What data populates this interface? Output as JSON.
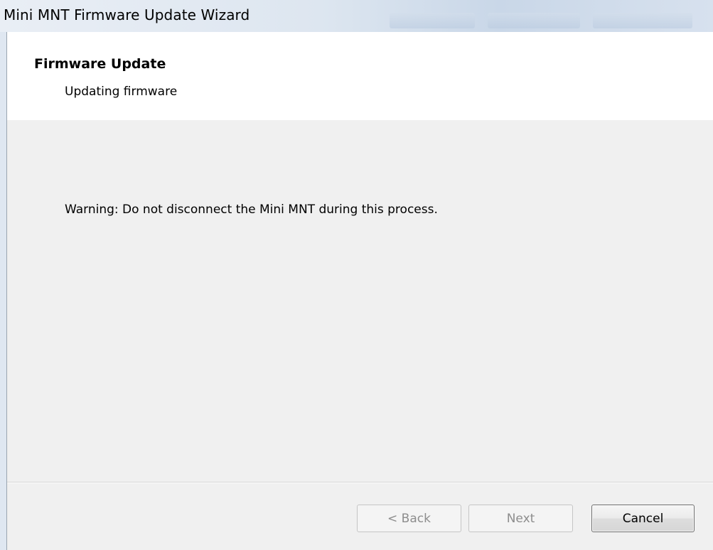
{
  "window": {
    "title": "Mini MNT Firmware Update Wizard"
  },
  "header": {
    "title": "Firmware Update",
    "subtitle": "Updating firmware"
  },
  "content": {
    "warning": "Warning: Do not disconnect the Mini MNT during this process."
  },
  "buttons": {
    "back": "< Back",
    "next": "Next",
    "cancel": "Cancel"
  }
}
